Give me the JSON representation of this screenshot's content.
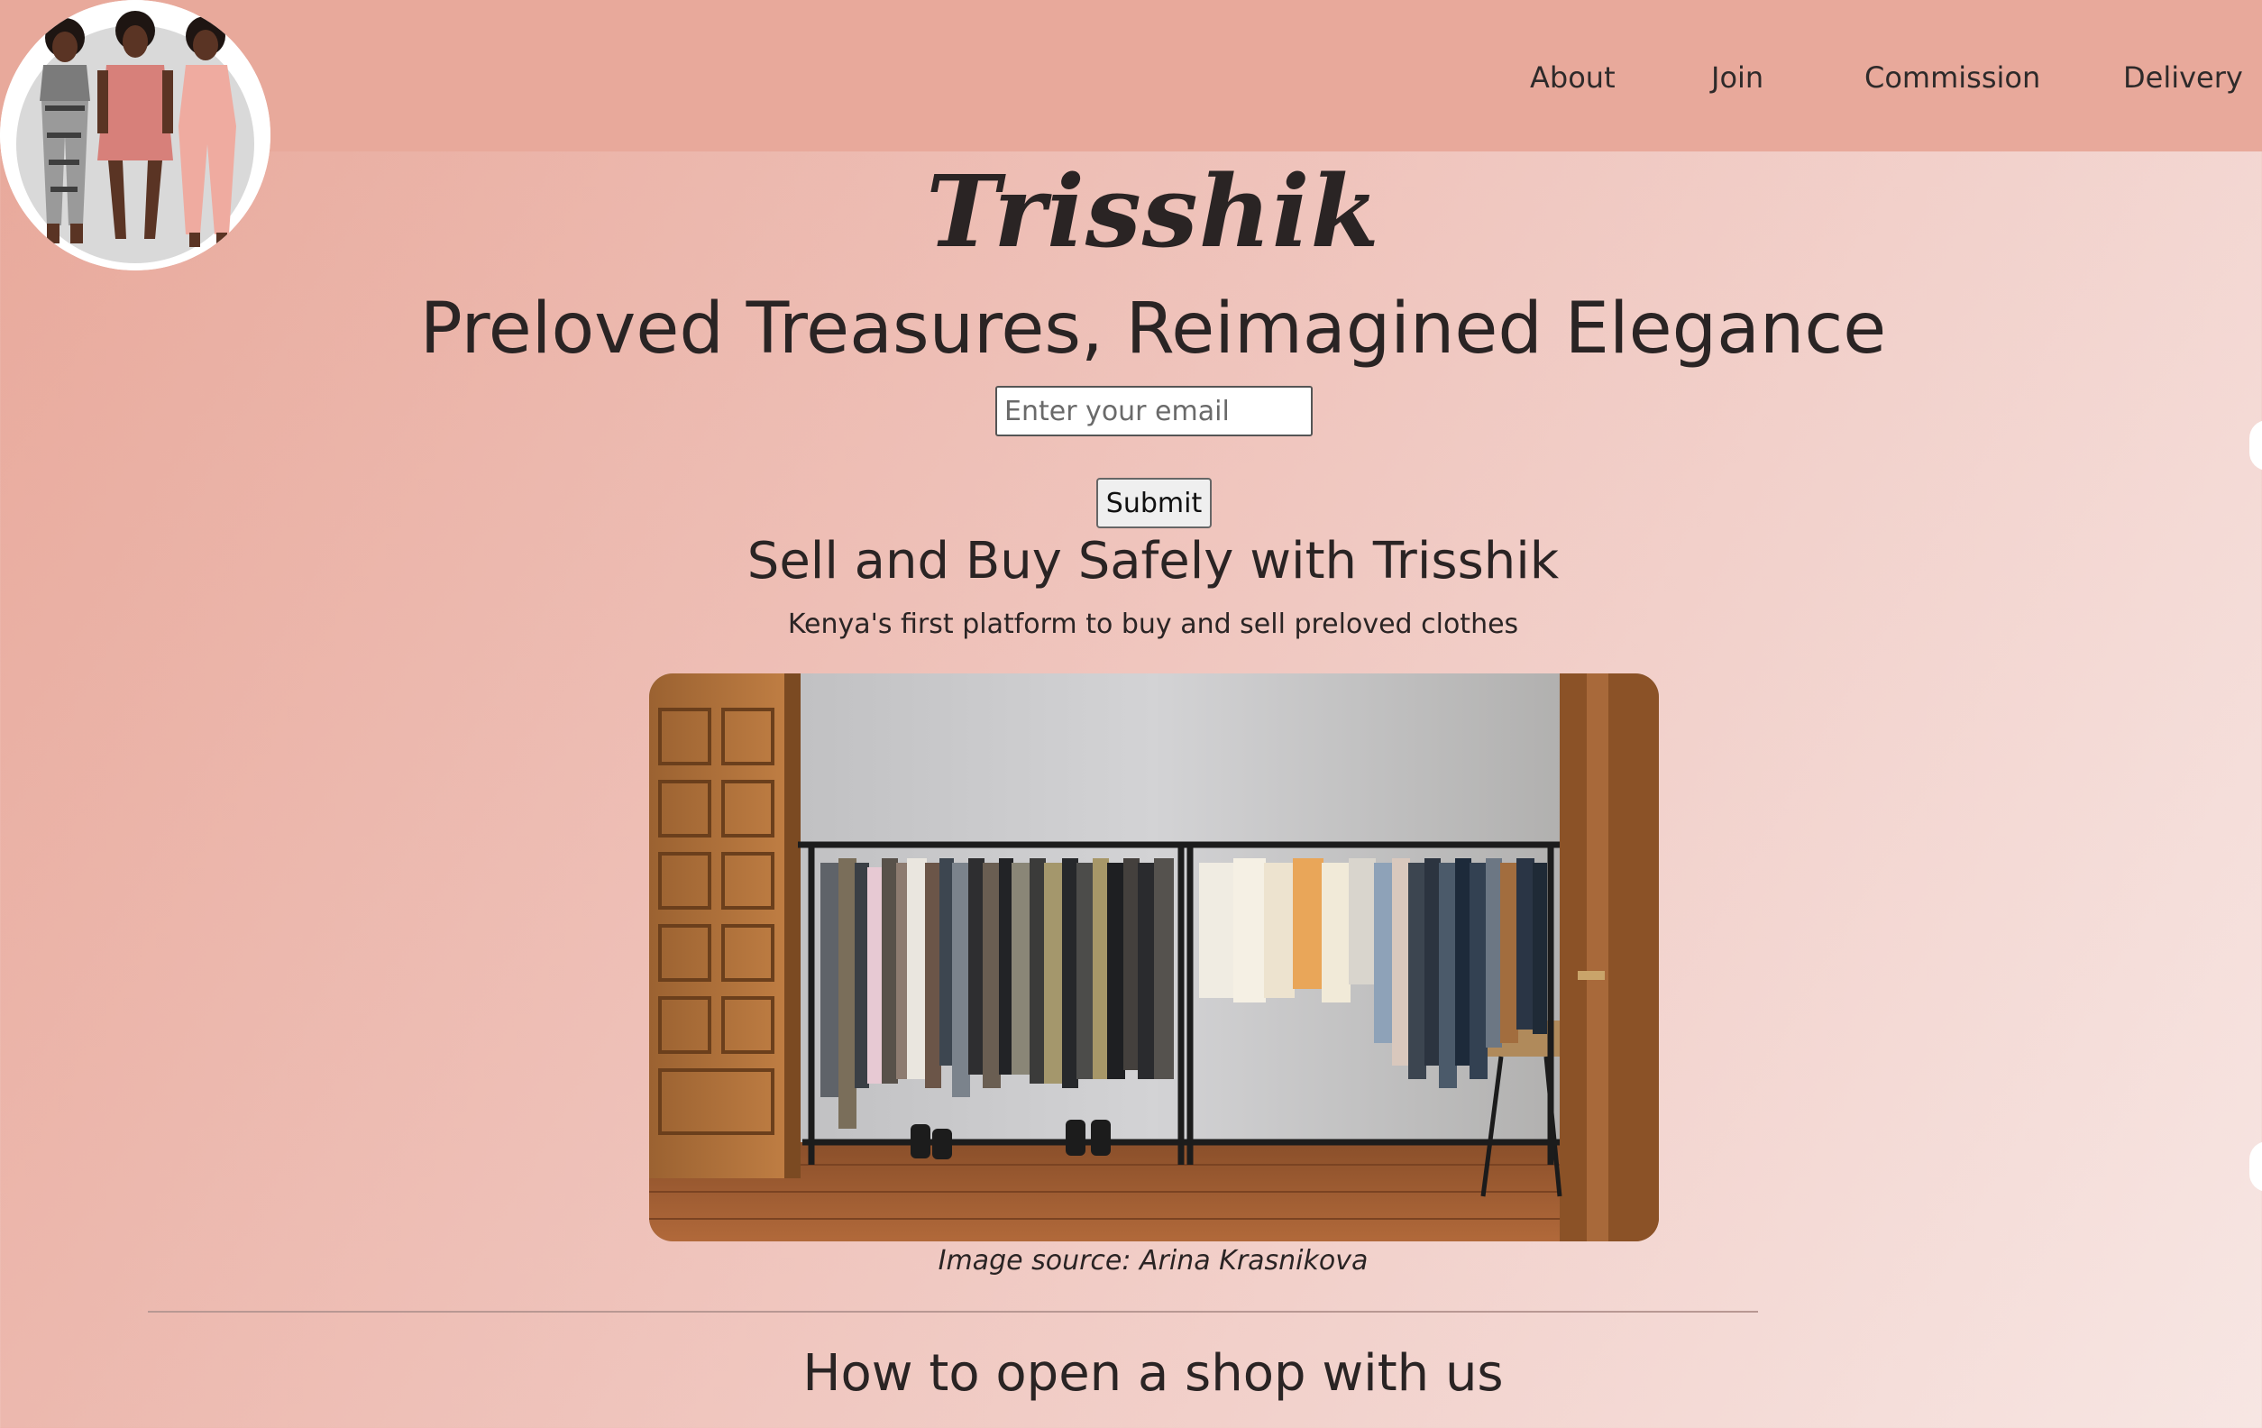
{
  "nav": {
    "about": "About",
    "join": "Join",
    "commission": "Commission",
    "delivery": "Delivery"
  },
  "brand": {
    "name": "Trisshik"
  },
  "hero": {
    "title": "Preloved Treasures, Reimagined Elegance",
    "email_placeholder": "Enter your email",
    "submit_label": "Submit"
  },
  "section": {
    "title": "Sell and Buy Safely with Trisshik",
    "tagline": "Kenya's first platform to buy and sell preloved clothes",
    "image_caption": "Image source: Arina Krasnikova"
  },
  "how": {
    "title": "How to open a shop with us"
  },
  "colors": {
    "header_bg": "#e8a99b",
    "text": "#2a2424"
  }
}
